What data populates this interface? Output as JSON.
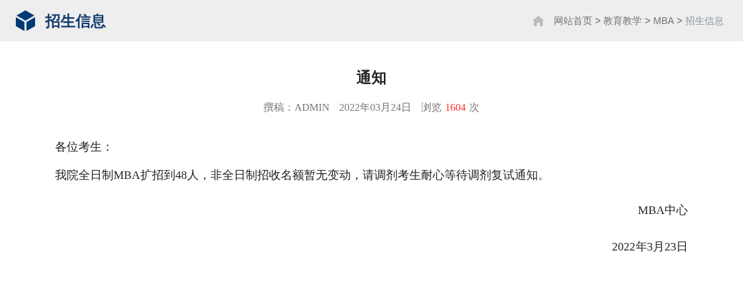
{
  "header": {
    "title": "招生信息"
  },
  "breadcrumb": [
    {
      "label": "网站首页",
      "current": false
    },
    {
      "label": "教育教学",
      "current": false
    },
    {
      "label": "MBA",
      "current": false
    },
    {
      "label": "招生信息",
      "current": true
    }
  ],
  "breadcrumb_separator": ">",
  "article": {
    "title": "通知",
    "meta": {
      "author": "撰稿：ADMIN",
      "date": "2022年03月24日",
      "views_label": "浏览",
      "views": "1604",
      "views_unit": "次"
    },
    "paragraphs": [
      "各位考生：",
      "我院全日制MBA扩招到48人，非全日制招收名额暂无变动，请调剂考生耐心等待调剂复试通知。"
    ],
    "signature": [
      "MBA中心",
      "2022年3月23日"
    ]
  }
}
